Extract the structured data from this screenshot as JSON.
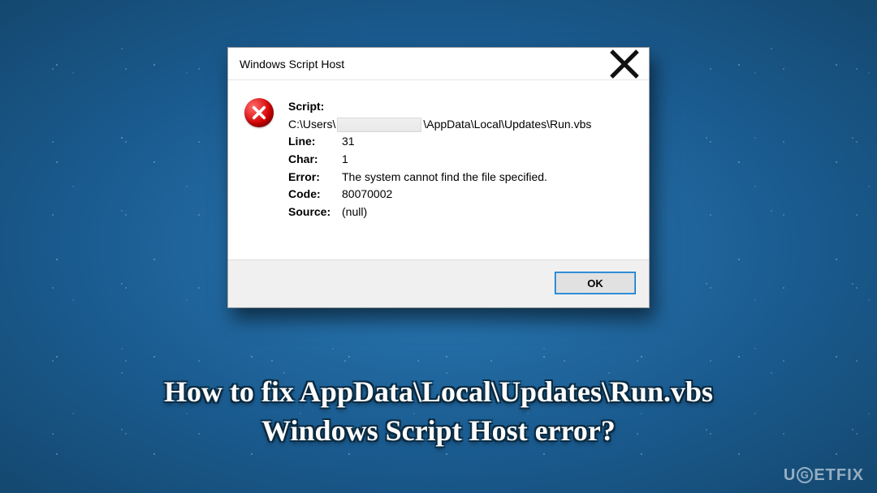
{
  "dialog": {
    "title": "Windows Script Host",
    "script_label": "Script:",
    "path_prefix": "C:\\Users\\",
    "path_suffix": "\\AppData\\Local\\Updates\\Run.vbs",
    "rows": {
      "line": {
        "label": "Line:",
        "value": "31"
      },
      "char": {
        "label": "Char:",
        "value": "1"
      },
      "error": {
        "label": "Error:",
        "value": "The system cannot find the file specified."
      },
      "code": {
        "label": "Code:",
        "value": "80070002"
      },
      "source": {
        "label": "Source:",
        "value": "(null)"
      }
    },
    "ok_label": "OK"
  },
  "banner": {
    "line1": "How to fix AppData\\Local\\Updates\\Run.vbs",
    "line2": "Windows Script Host error?"
  },
  "watermark": {
    "pre": "U",
    "mid": "G",
    "post": "ETFIX"
  }
}
